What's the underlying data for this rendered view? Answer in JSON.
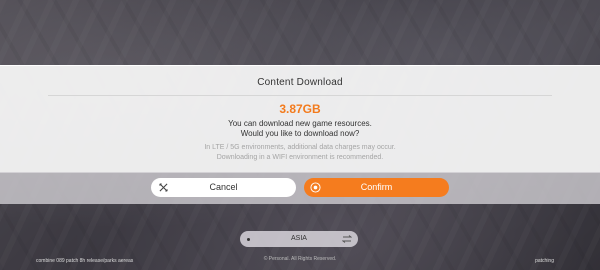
{
  "dialog": {
    "title": "Content Download",
    "size": "3.87GB",
    "message_line1": "You can download new game resources.",
    "message_line2": "Would you like to download now?",
    "note_line1": "In LTE / 5G environments, additional data charges may occur.",
    "note_line2": "Downloading in a WIFI environment is recommended.",
    "cancel_label": "Cancel",
    "confirm_label": "Confirm"
  },
  "region": {
    "label": "ASIA"
  },
  "footer": {
    "left": "combine 089 patch 8h release/parks aereas",
    "center": "© Personal. All Rights Reserved.",
    "right": "patching"
  },
  "colors": {
    "accent": "#f57c1e",
    "accent_text": "#f37b1d"
  },
  "icons": {
    "cancel": "close-icon",
    "confirm": "confirm-circle-icon",
    "region_swap": "swap-arrows-icon"
  }
}
